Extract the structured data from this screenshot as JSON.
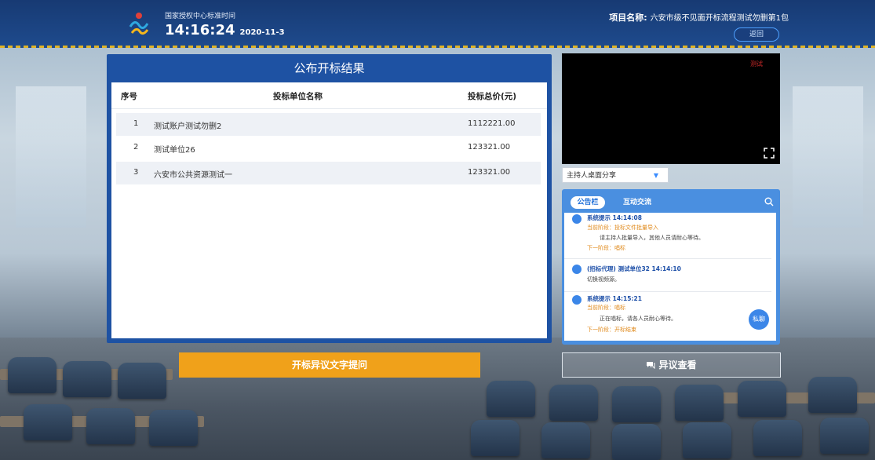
{
  "header": {
    "center_name": "国家授权中心标准时间",
    "time": "14:16:24",
    "date": "2020-11-3",
    "project_label": "项目名称:",
    "project_name": "六安市级不见面开标流程测试勿删第1包",
    "back_label": "返回"
  },
  "results": {
    "title": "公布开标结果",
    "columns": [
      "序号",
      "投标单位名称",
      "投标总价(元)"
    ],
    "rows": [
      {
        "index": "1",
        "name": "测试账户测试勿删2",
        "price": "1112221.00"
      },
      {
        "index": "2",
        "name": "测试单位26",
        "price": "123321.00"
      },
      {
        "index": "3",
        "name": "六安市公共资源测试一",
        "price": "123321.00"
      }
    ]
  },
  "video": {
    "tag": "测试",
    "share_select": "主持人桌面分享"
  },
  "chat": {
    "tabs": [
      "公告栏",
      "互动交流"
    ],
    "messages": [
      {
        "head": "系统提示 14:14:08",
        "stage": "当前阶段：投标文件批量导入",
        "text": "请主持人批量导入，其他人员请耐心等待。",
        "next": "下一阶段：唱标"
      },
      {
        "head": "(招标代理)  测试单位32 14:14:10",
        "text": "切换视频源。"
      },
      {
        "head": "系统提示 14:15:21",
        "stage": "当前阶段：唱标",
        "text": "正在唱标，请各人员耐心等待。",
        "next": "下一阶段：开标结束"
      }
    ],
    "private_label": "私聊"
  },
  "actions": {
    "objection_text": "开标异议文字提问",
    "view_objection": "异议查看"
  },
  "colors": {
    "header": "#1e4a8c",
    "panel": "#1e52a3",
    "accent": "#f0a11a"
  }
}
